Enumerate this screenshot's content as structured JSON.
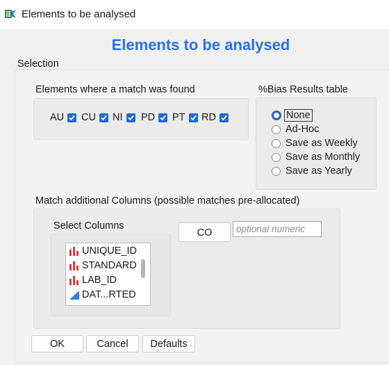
{
  "window": {
    "title": "Elements to be analysed"
  },
  "heading": "Elements to be analysed",
  "selection": {
    "label": "Selection",
    "elements_group": {
      "label": "Elements where a match was found",
      "items": [
        {
          "label": "AU",
          "checked": true
        },
        {
          "label": "CU",
          "checked": true
        },
        {
          "label": "NI",
          "checked": true
        },
        {
          "label": "PD",
          "checked": true
        },
        {
          "label": "PT",
          "checked": true
        },
        {
          "label": "RD",
          "checked": true
        }
      ]
    },
    "bias_group": {
      "label": "%Bias Results table",
      "options": [
        "None",
        "Ad-Hoc",
        "Save as Weekly",
        "Save as Monthly",
        "Save as Yearly"
      ],
      "selected": "None"
    },
    "match_group": {
      "label": "Match additional Columns (possible matches pre-allocated)",
      "select_columns_label": "Select Columns",
      "columns": [
        {
          "name": "UNIQUE_ID",
          "icon": "bar-chart-icon"
        },
        {
          "name": "STANDARD",
          "icon": "bar-chart-icon"
        },
        {
          "name": "LAB_ID",
          "icon": "bar-chart-icon"
        },
        {
          "name": "DAT...RTED",
          "icon": "continuous-icon"
        }
      ],
      "co_button": "CO",
      "optional_placeholder": "optional numeric"
    }
  },
  "buttons": {
    "ok": "OK",
    "cancel": "Cancel",
    "defaults": "Defaults"
  },
  "colors": {
    "heading": "#2b6ff2",
    "checkbox": "#1f6cd1",
    "bar_icon": "#e03c31",
    "continuous_icon": "#2f7fd6"
  }
}
